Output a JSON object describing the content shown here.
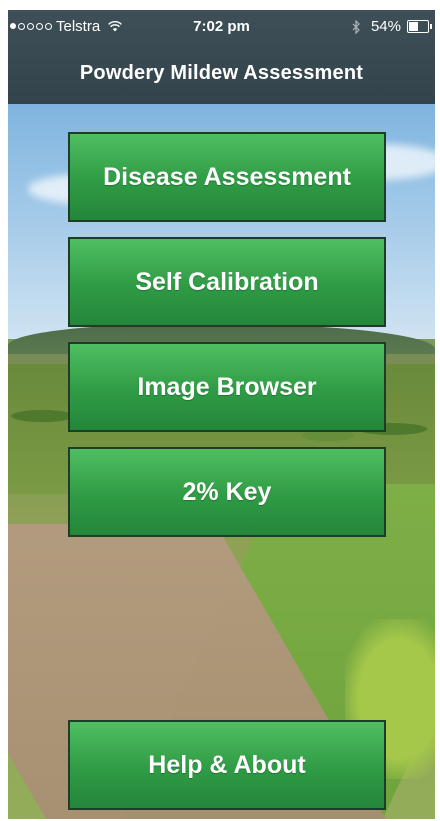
{
  "status_bar": {
    "carrier": "Telstra",
    "signal": {
      "full_dots": 1,
      "empty_dots": 4
    },
    "time": "7:02 pm",
    "battery_percent_text": "54%",
    "battery_level": 0.54
  },
  "navbar": {
    "title": "Powdery Mildew Assessment"
  },
  "menu": {
    "disease_assessment": "Disease Assessment",
    "self_calibration": "Self Calibration",
    "image_browser": "Image Browser",
    "two_percent_key": "2% Key",
    "help_about": "Help & About"
  },
  "icons": [
    "wifi-icon",
    "bluetooth-icon",
    "battery-icon"
  ],
  "colors": {
    "navbar_bg": "#3e4f57",
    "button_green": "#2f9b45",
    "button_border": "#1e3c28"
  }
}
